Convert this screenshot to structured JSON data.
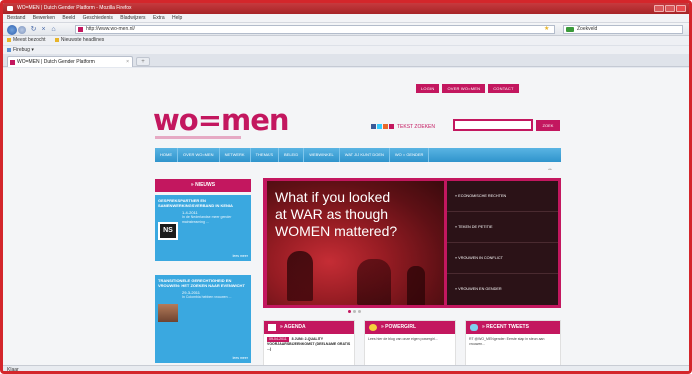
{
  "window": {
    "title": "WO=MEN | Dutch Gender Platform - Mozilla Firefox"
  },
  "menubar": {
    "items": [
      "Bestand",
      "Bewerken",
      "Beeld",
      "Geschiedenis",
      "Bladwijzers",
      "Extra",
      "Help"
    ]
  },
  "navbar": {
    "url": "http://www.wo-men.nl/",
    "search_engine": "Google",
    "search_placeholder": "Zoekveld"
  },
  "bookmarks": {
    "items": [
      "Meest bezocht",
      "Nieuwste headlines"
    ]
  },
  "devbar": {
    "label": "Firebug"
  },
  "tab": {
    "title": "WO=MEN | Dutch Gender Platform"
  },
  "page": {
    "top_links": [
      "Login",
      "Over WO=MEN",
      "Contact"
    ],
    "logo": "wo=men",
    "textsize_label": "TEKST ZOEKEN",
    "search_button": "ZOEK",
    "nav": [
      "Home",
      "Over WO=MEN",
      "Netwerk",
      "Thema's",
      "Beleid",
      "Webwinkel",
      "Wat jij kunt doen",
      "WO = GENDER"
    ],
    "news_header": "» NIEUWS",
    "news": [
      {
        "title": "Gesprekspartner en samenwerkingsverband in Kenia",
        "date": "1-4-2011",
        "body": "In de Nederlandse meer gender mainstreaming ...",
        "more": "lees meer"
      },
      {
        "title": "Transitionele gerechtigheid en vrouwen: het zoeken naar evenwicht",
        "date": "29-3-2011",
        "body": "In Colombia hebben vrouwen ...",
        "more": "lees meer"
      }
    ],
    "feature": {
      "line1": "What if you looked",
      "line2": "at WAR as though",
      "line3": "WOMEN mattered?",
      "menu": [
        "» Economische rechten",
        "» Teken de petitie",
        "» Vrouwen in conflict",
        "» Vrouwen en gender"
      ]
    },
    "boxes": {
      "agenda": {
        "title": "» AGENDA",
        "tag": "09-04-2011",
        "item_title": "8 juni: 2-Quality voorjaarsbijeenkomst (Deelname gratis ...)"
      },
      "powergirl": {
        "title": "» POWERGIRL",
        "body": "Lees hier de blog van onze eigen powergirl..."
      },
      "tweets": {
        "title": "» RECENT TWEETS",
        "body": "RT @WO_MENgender: Eerste stap in steun aan vrouwen..."
      }
    }
  },
  "statusbar": {
    "text": "Klaar"
  }
}
